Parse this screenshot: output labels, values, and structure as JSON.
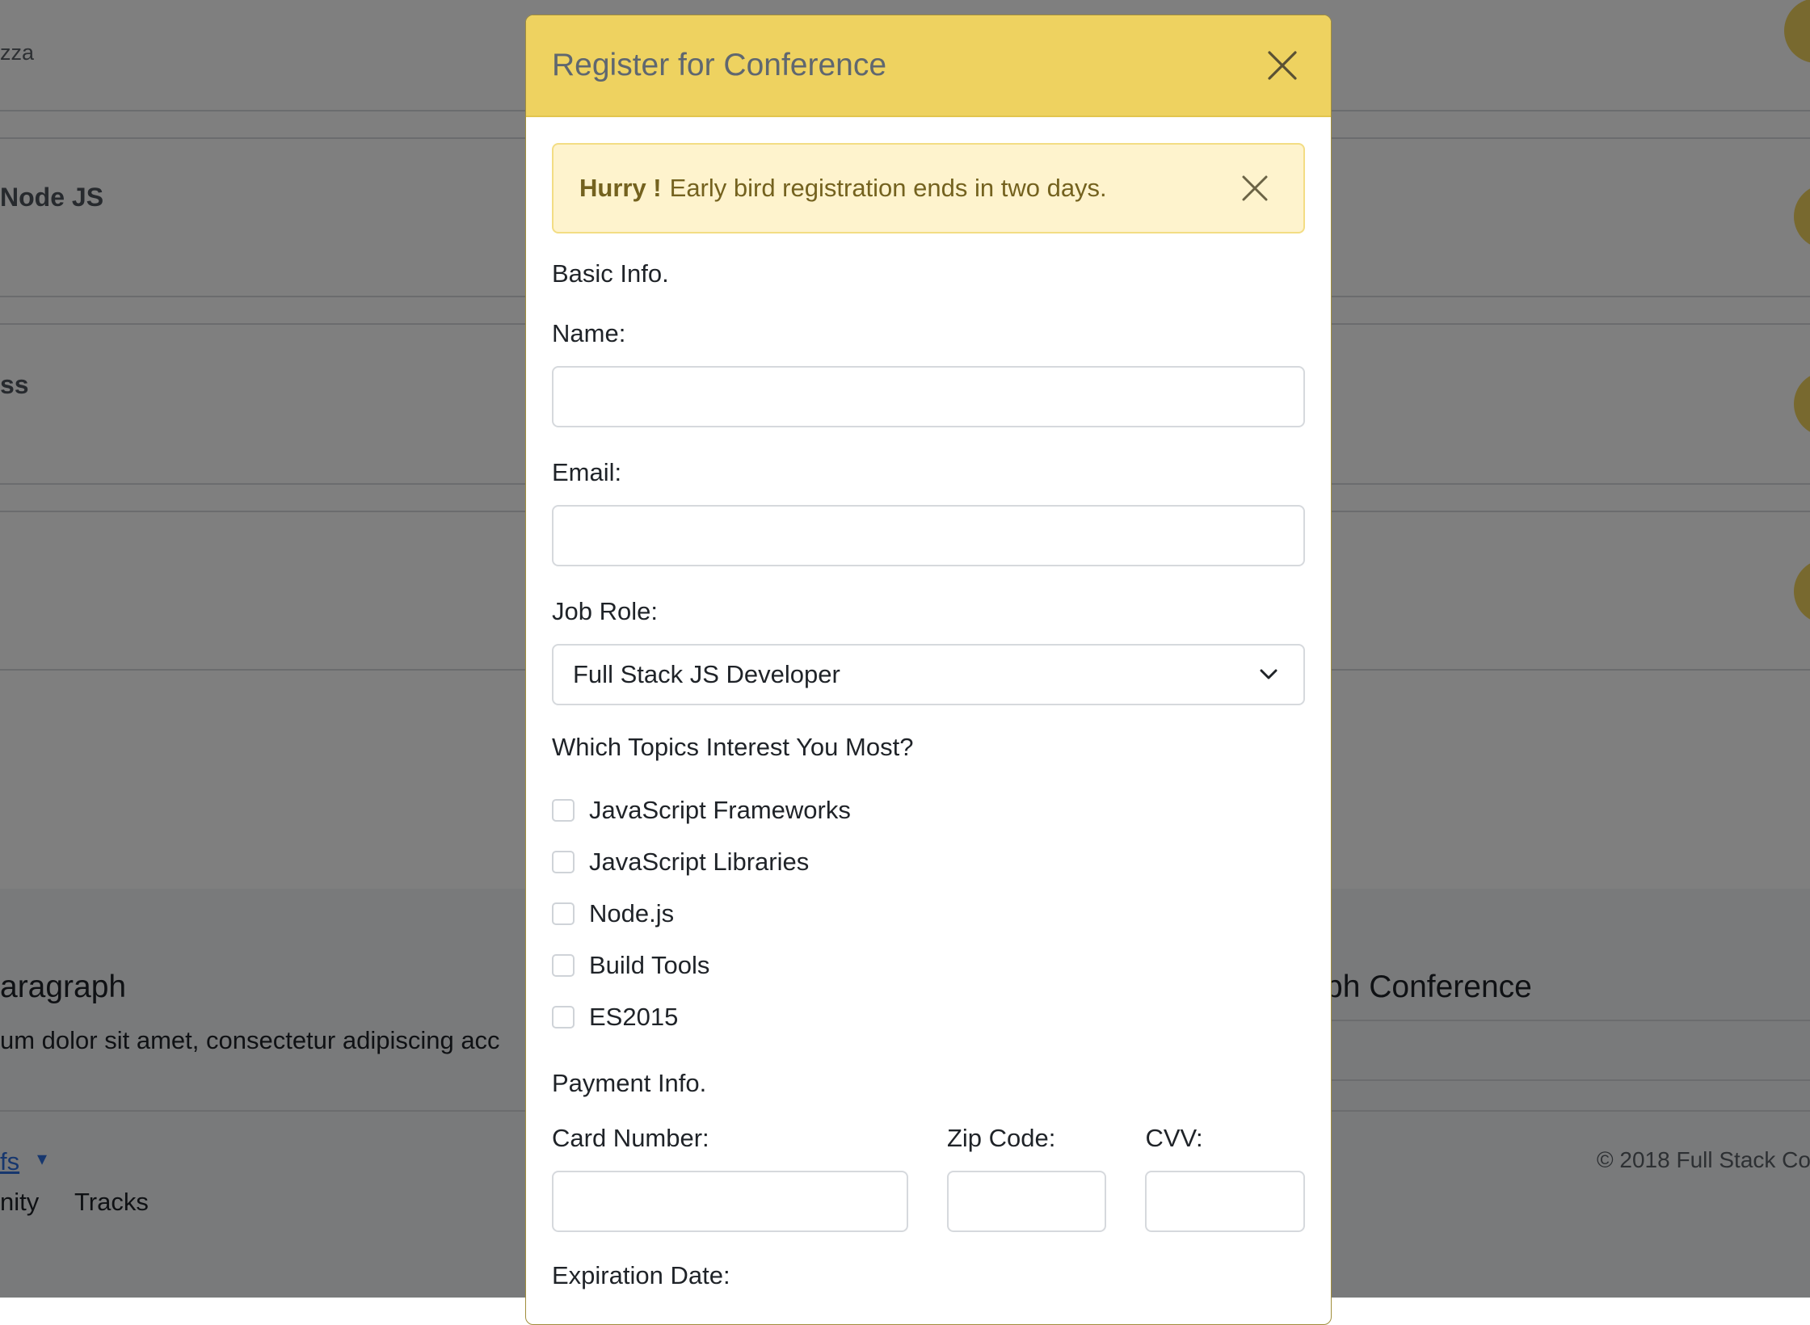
{
  "background": {
    "snippets": {
      "pizza": "zza",
      "node": "Node JS",
      "css": "ss",
      "paragraph_heading": "aragraph",
      "paragraph_text": "um dolor sit amet, consectetur adipiscing acc",
      "conference_heading": "ph Conference",
      "link_fs": "fs",
      "nav_community": "nity",
      "nav_tracks": "Tracks",
      "copyright": "© 2018 Full Stack Co"
    }
  },
  "modal": {
    "title": "Register for Conference",
    "alert": {
      "strong": "Hurry !",
      "message": "Early bird registration ends in two days."
    },
    "basic_info_title": "Basic Info.",
    "name_label": "Name:",
    "name_value": "",
    "email_label": "Email:",
    "email_value": "",
    "job_role_label": "Job Role:",
    "job_role_selected": "Full Stack JS Developer",
    "topics_title": "Which Topics Interest You Most?",
    "topics": [
      {
        "label": "JavaScript Frameworks",
        "checked": false
      },
      {
        "label": "JavaScript Libraries",
        "checked": false
      },
      {
        "label": "Node.js",
        "checked": false
      },
      {
        "label": "Build Tools",
        "checked": false
      },
      {
        "label": "ES2015",
        "checked": false
      }
    ],
    "payment_info_title": "Payment Info.",
    "card_number_label": "Card Number:",
    "zip_code_label": "Zip Code:",
    "cvv_label": "CVV:",
    "expiration_label": "Expiration Date:"
  },
  "colors": {
    "header": "#eed260",
    "alert_bg": "#fef3cd",
    "alert_text": "#74621f",
    "overlay": "rgba(0,0,0,0.5)"
  }
}
